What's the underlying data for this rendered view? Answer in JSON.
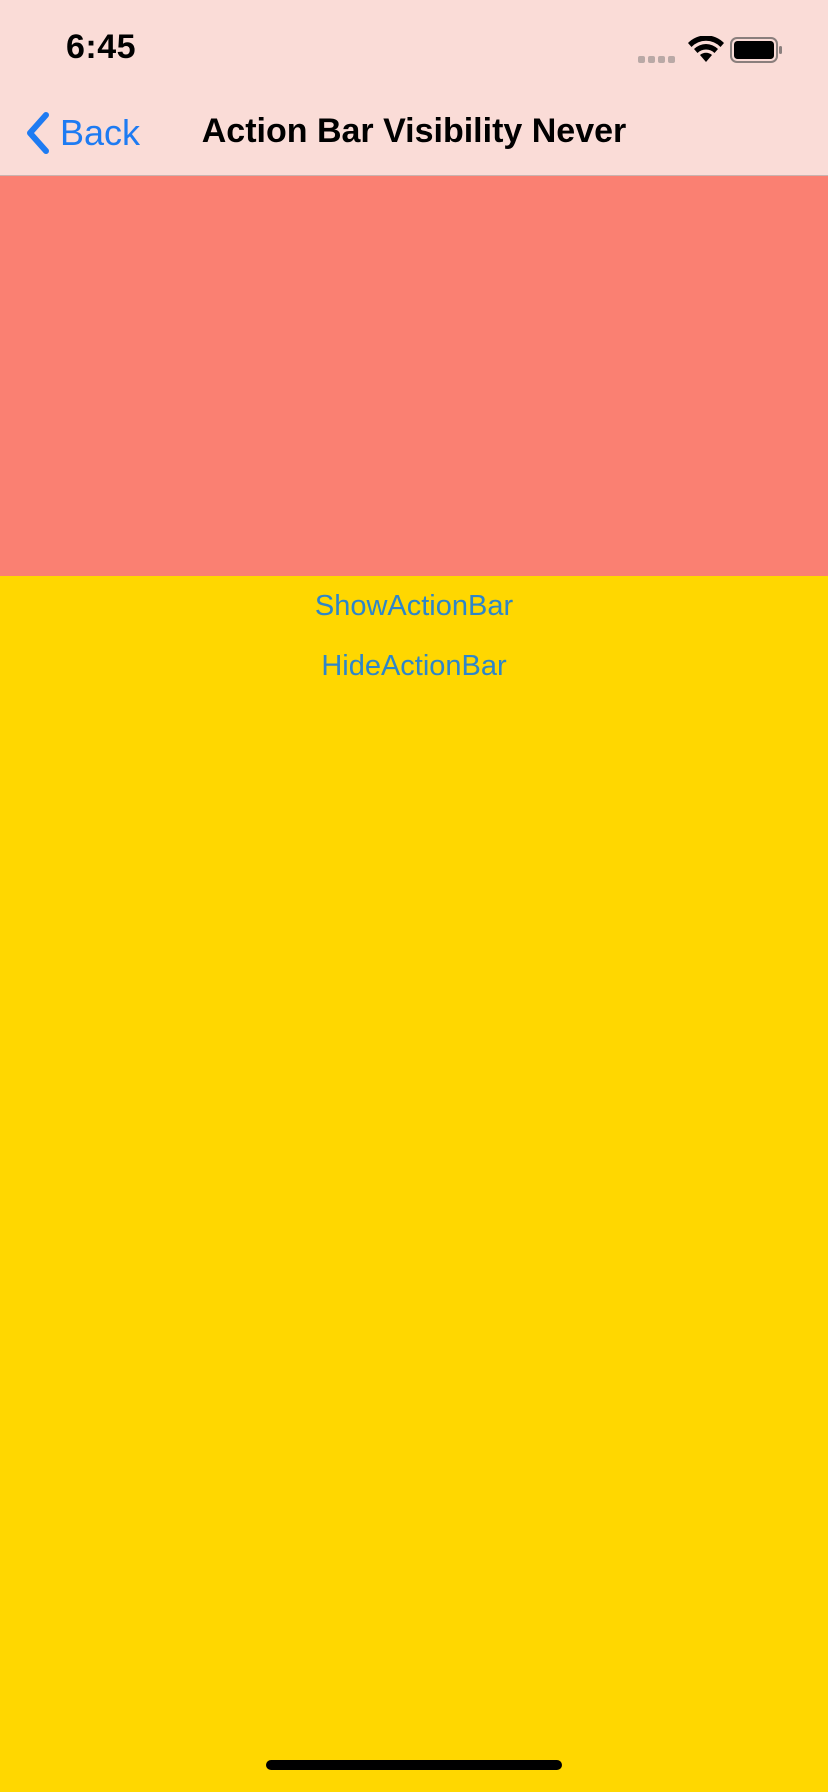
{
  "status_bar": {
    "time": "6:45"
  },
  "nav_bar": {
    "back_label": "Back",
    "title": "Action Bar Visibility Never"
  },
  "content": {
    "show_button_label": "ShowActionBar",
    "hide_button_label": "HideActionBar"
  },
  "colors": {
    "topbar_background": "#FADCD7",
    "red_panel": "#FA8072",
    "page_background": "#FFD700",
    "link_blue": "#2E86C9",
    "back_blue": "#1E7BF2"
  },
  "icons": {
    "back": "chevron-left-icon",
    "signal": "cellular-signal-icon",
    "wifi": "wifi-icon",
    "battery": "battery-icon"
  }
}
